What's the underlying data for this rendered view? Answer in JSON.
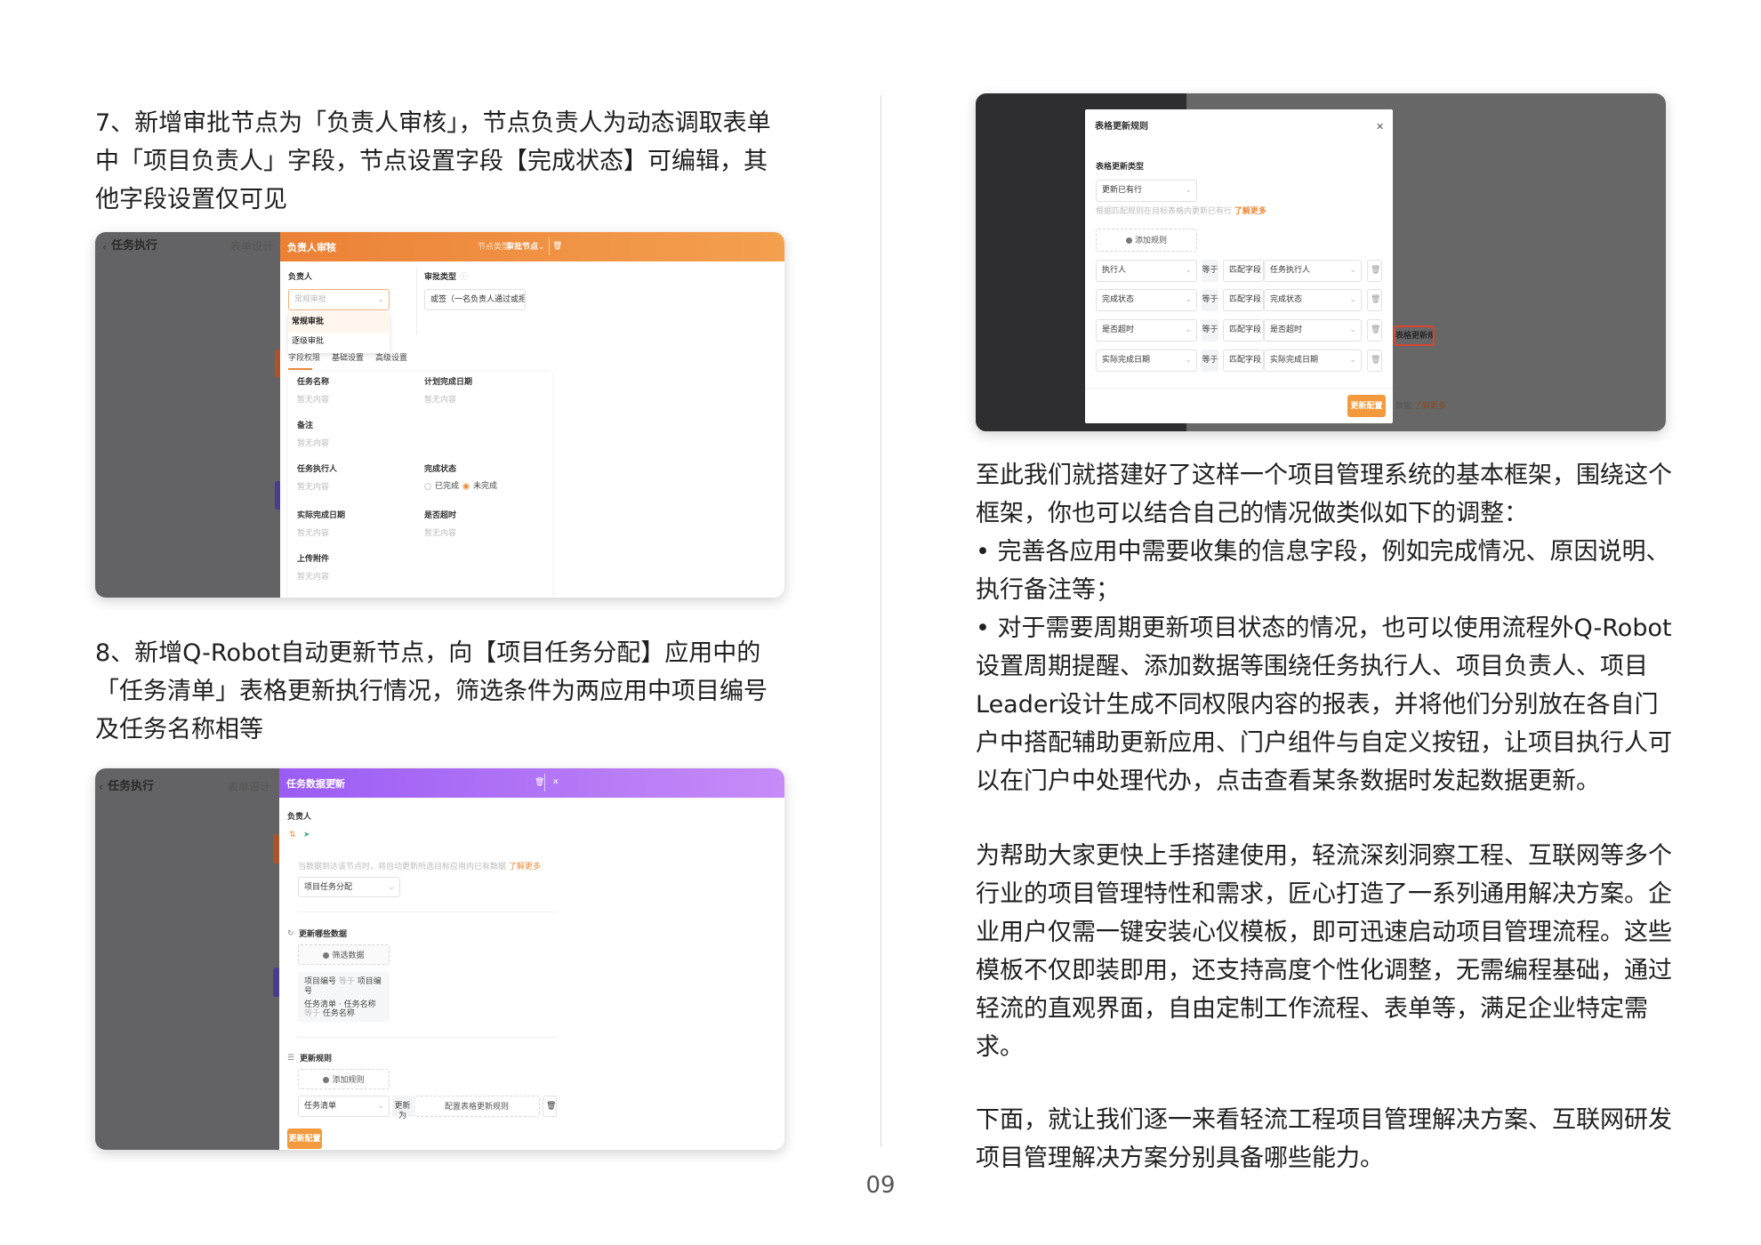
{
  "left": {
    "step7": "7、新增审批节点为「负责人审核」，节点负责人为动态调取表单中「项目负责人」字段，节点设置字段【完成状态】可编辑，其他字段设置仅可见",
    "step8": "8、新增Q-Robot自动更新节点，向【项目任务分配】应用中的「任务清单」表格更新执行情况，筛选条件为两应用中项目编号及任务名称相等"
  },
  "shot1": {
    "back_title": "任务执行",
    "bg_tab": "表单设计",
    "panel_title": "负责人审核",
    "node_type": "节点类型",
    "node_kind": "审批节点",
    "owner_label": "负责人",
    "owner_placeholder": "常规审批",
    "owner_options": [
      "常规审批",
      "逐级审批"
    ],
    "approval_label": "审批类型",
    "approval_value": "或签（一名负责人通过或拒绝即可）",
    "tabs": [
      "字段权限",
      "基础设置",
      "高级设置"
    ],
    "active_tab": "字段权限",
    "empty": "暂无内容",
    "fields": {
      "task_name": "任务名称",
      "plan_date": "计划完成日期",
      "note": "备注",
      "executor": "任务执行人",
      "status": "完成状态",
      "status_done": "已完成",
      "status_undone": "未完成",
      "status_selected": "未完成",
      "actual_date": "实际完成日期",
      "overtime": "是否超时",
      "attachment": "上传附件"
    },
    "accent": "#f08a3a"
  },
  "shot2": {
    "back_title": "任务执行",
    "bg_tab": "表单设计",
    "panel_title": "任务数据更新",
    "owner_label": "负责人",
    "hint": "当数据到达该节点时，将自动更新所选目标应用内已有数据",
    "learn_more": "了解更多",
    "target_app": "项目任务分配",
    "which_data": "更新哪些数据",
    "filter_btn": "筛选数据",
    "cond1": {
      "a": "项目编号",
      "op": "等于",
      "b": "项目编号"
    },
    "cond2": {
      "a": "任务清单 · 任务名称",
      "op": "等于",
      "b": "任务名称"
    },
    "rules_title": "更新规则",
    "add_rule": "添加规则",
    "rule_table": "任务清单",
    "update_to": "更新为",
    "config_rule": "配置表格更新规则",
    "save": "更新配置",
    "accent": "#a06af5"
  },
  "shot3": {
    "modal_title": "表格更新规则",
    "type_label": "表格更新类型",
    "type_value": "更新已有行",
    "hint": "根据匹配规则在目标表格内更新已有行",
    "learn_more": "了解更多",
    "add_rule": "添加规则",
    "rules": [
      {
        "field": "执行人",
        "op": "等于",
        "mode": "匹配字段",
        "value": "任务执行人"
      },
      {
        "field": "完成状态",
        "op": "等于",
        "mode": "匹配字段",
        "value": "完成状态"
      },
      {
        "field": "是否超时",
        "op": "等于",
        "mode": "匹配字段",
        "value": "是否超时"
      },
      {
        "field": "实际完成日期",
        "op": "等于",
        "mode": "匹配字段",
        "value": "实际完成日期"
      }
    ],
    "save": "更新配置",
    "behind_button": "表格更新规则",
    "behind_text": "数据",
    "behind_link": "了解更多"
  },
  "right": {
    "p1": [
      "至此我们就搭建好了这样一个项目管理系统的基本框架，围绕这个框架，你也可以结合自己的情况做类似如下的调整：",
      "• 完善各应用中需要收集的信息字段，例如完成情况、原因说明、执行备注等；",
      "• 对于需要周期更新项目状态的情况，也可以使用流程外Q-Robot设置周期提醒、添加数据等围绕任务执行人、项目负责人、项目Leader设计生成不同权限内容的报表，并将他们分别放在各自门户中搭配辅助更新应用、门户组件与自定义按钮，让项目执行人可以在门户中处理代办，点击查看某条数据时发起数据更新。"
    ],
    "p2": "为帮助大家更快上手搭建使用，轻流深刻洞察工程、互联网等多个行业的项目管理特性和需求，匠心打造了一系列通用解决方案。企业用户仅需一键安装心仪模板，即可迅速启动项目管理流程。这些模板不仅即装即用，还支持高度个性化调整，无需编程基础，通过轻流的直观界面，自由定制工作流程、表单等，满足企业特定需求。",
    "p3": "下面，就让我们逐一来看轻流工程项目管理解决方案、互联网研发项目管理解决方案分别具备哪些能力。"
  },
  "page_number": "09"
}
